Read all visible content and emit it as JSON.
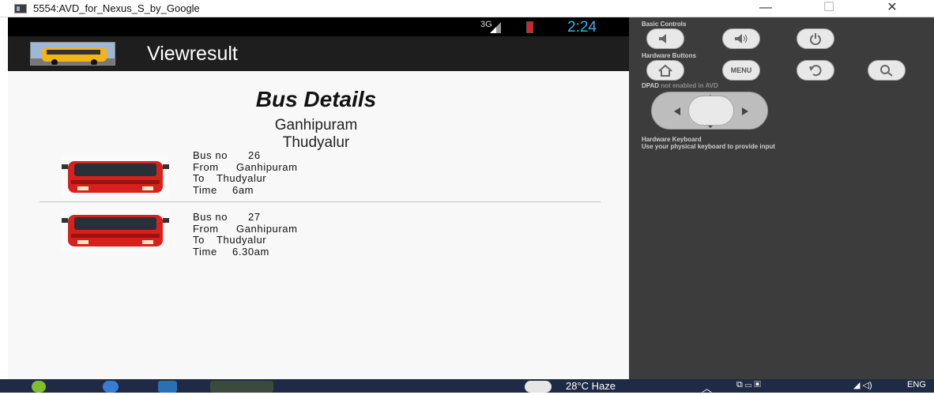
{
  "window": {
    "title": "5554:AVD_for_Nexus_S_by_Google",
    "minimize": "—",
    "maximize": "☐",
    "close": "✕"
  },
  "status_bar": {
    "network": "3G",
    "time": "2:24"
  },
  "action_bar": {
    "title": "Viewresult"
  },
  "content": {
    "heading": "Bus Details",
    "from_place": "Ganhipuram",
    "to_place": "Thudyalur",
    "buses": [
      {
        "bus_no_label": "Bus no",
        "bus_no": "26",
        "from_label": "From",
        "from": "Ganhipuram",
        "to_label": "To",
        "to": "Thudyalur",
        "time_label": "Time",
        "time": "6am"
      },
      {
        "bus_no_label": "Bus no",
        "bus_no": "27",
        "from_label": "From",
        "from": "Ganhipuram",
        "to_label": "To",
        "to": "Thudyalur",
        "time_label": "Time",
        "time": "6.30am"
      }
    ]
  },
  "controls": {
    "basic_label": "Basic Controls",
    "hardware_label": "Hardware Buttons",
    "menu_button": "MENU",
    "dpad_label": "DPAD",
    "dpad_note": "not enabled in AVD",
    "keyboard_label": "Hardware Keyboard",
    "keyboard_note": "Use your physical keyboard to provide input"
  },
  "taskbar": {
    "weather": "28°C  Haze",
    "lang": "ENG"
  },
  "colors": {
    "clock": "#33b5e5",
    "bus_red": "#d8211d",
    "panel_bg": "#3c3c3c",
    "taskbar_bg": "#1f2a44"
  }
}
